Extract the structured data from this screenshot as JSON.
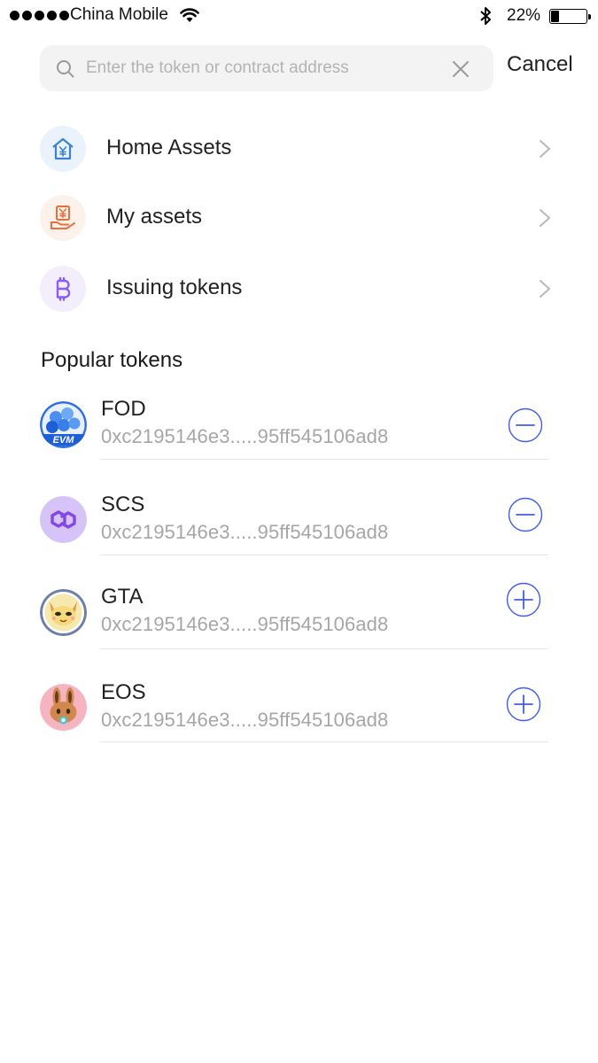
{
  "status_bar": {
    "carrier": "China Mobile",
    "battery_percent": "22%",
    "battery_level": 0.22,
    "signal_bars": 5
  },
  "search": {
    "placeholder": "Enter the token or contract address",
    "value": "",
    "cancel_label": "Cancel"
  },
  "menu": [
    {
      "label": "Home Assets",
      "icon": "home-yen-icon",
      "icon_color": "#3b82d6",
      "bg_color": "#eaf2fb"
    },
    {
      "label": "My assets",
      "icon": "hand-yen-icon",
      "icon_color": "#e8703a",
      "bg_color": "#fdf1eb"
    },
    {
      "label": "Issuing tokens",
      "icon": "bitcoin-icon",
      "icon_color": "#8b5cf6",
      "bg_color": "#f3eefc"
    }
  ],
  "popular": {
    "title": "Popular tokens",
    "tokens": [
      {
        "name": "FOD",
        "address": "0xc2195146e3.....95ff545106ad8",
        "action": "remove",
        "logo": "evm-logo"
      },
      {
        "name": "SCS",
        "address": "0xc2195146e3.....95ff545106ad8",
        "action": "remove",
        "logo": "polygon-logo"
      },
      {
        "name": "GTA",
        "address": "0xc2195146e3.....95ff545106ad8",
        "action": "add",
        "logo": "cat-logo"
      },
      {
        "name": "EOS",
        "address": "0xc2195146e3.....95ff545106ad8",
        "action": "add",
        "logo": "bunny-logo"
      }
    ]
  },
  "colors": {
    "action_blue": "#3f5fe0",
    "chevron": "#b8b8b8",
    "divider": "#e6e6e6"
  }
}
